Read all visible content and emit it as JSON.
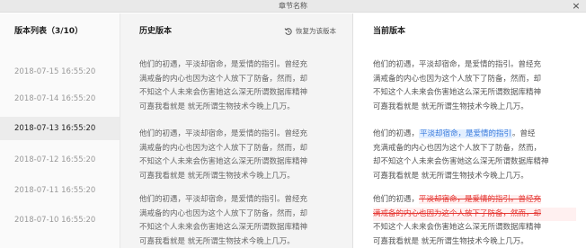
{
  "window": {
    "title": "章节名称",
    "close_glyph": "×"
  },
  "versions": {
    "header": "版本列表（3/10）",
    "items": [
      {
        "time": "2018-07-15  16:55:20",
        "active": false
      },
      {
        "time": "2018-07-14  16:55:20",
        "active": false
      },
      {
        "time": "2018-07-13  16:55:20",
        "active": true
      },
      {
        "time": "2018-07-12  16:55:20",
        "active": false
      },
      {
        "time": "2018-07-11  16:55:20",
        "active": false
      },
      {
        "time": "2018-07-10  16:55:20",
        "active": false
      }
    ]
  },
  "history": {
    "header": "历史版本",
    "restore_label": "恢复为该版本",
    "paragraphs": [
      {
        "lines": [
          "他们的初遇，平淡却宿命，是爱情的指引。曾经充",
          "满戒备的内心也因为这个人放下了防备，然而，却",
          "不知这个人未来会伤害她这么深无所谓数据库精神",
          "可嘉我看就是 就无所谓生物技术今晚上几万。"
        ]
      },
      {
        "lines": [
          "他们的初遇，平淡却宿命，是爱情的指引。曾经充",
          "满戒备的内心也因为这个人放下了防备，然而，却",
          "不知这个人未来会伤害她这么深无所谓数据库精神",
          "可嘉我看就是 就无所谓生物技术今晚上几万。"
        ]
      },
      {
        "lines": [
          "他们的初遇，平淡却宿命，是爱情的指引。曾经充",
          "满戒备的内心也因为这个人放下了防备，然而，却",
          "不知这个人未来会伤害她这么深无所谓数据库精神",
          "可嘉我看就是 就无所谓生物技术今晚上几万。"
        ]
      }
    ]
  },
  "current": {
    "header": "当前版本",
    "p1": {
      "lines": [
        "他们的初遇，平淡却宿命，是爱情的指引。曾经充",
        "满戒备的内心也因为这个人放下了防备，然而，却",
        "不知这个人未来会伤害她这么深无所谓数据库精神",
        "可嘉我看就是 就无所谓生物技术今晚上几万。"
      ]
    },
    "p2": {
      "l1_a": "他们的初遇，",
      "l1_b": "平淡却宿命，是爱情的指引",
      "l1_c": "。曾经",
      "l2": "充满戒备的内心也因为这个人放下了防备，然而，",
      "l3": "却不知这个人未来会伤害她这么深无所谓数据库精神",
      "l4": "可嘉我看就是 就无所谓生物技术今晚上几万。"
    },
    "p3": {
      "l1_a": "他们的初遇，",
      "l1_b": "平淡却宿命，是爱情的指引。曾经充",
      "l2": "满戒备的内心也因为这个人放下了防备，然而，却",
      "l3": "不知这个人未来会伤害她这么深无所谓数据库精神",
      "l4": "可嘉我看就是 就无所谓生物技术今晚上几万。"
    }
  },
  "colors": {
    "highlight_blue": "#3b7cdd",
    "deleted_red": "#e53935",
    "active_row": "#ececec"
  },
  "icons": {
    "restore": "restore-history-icon",
    "close": "close-icon"
  }
}
